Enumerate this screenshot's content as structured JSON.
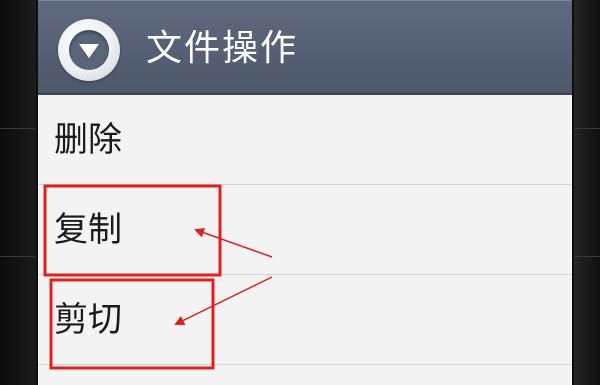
{
  "dialog": {
    "title": "文件操作",
    "header_icon": "dropdown-circle-icon",
    "items": [
      {
        "label": "删除"
      },
      {
        "label": "复制"
      },
      {
        "label": "剪切"
      }
    ]
  },
  "annotation": {
    "color": "#e0201f",
    "highlighted_items": [
      "复制",
      "剪切"
    ]
  }
}
